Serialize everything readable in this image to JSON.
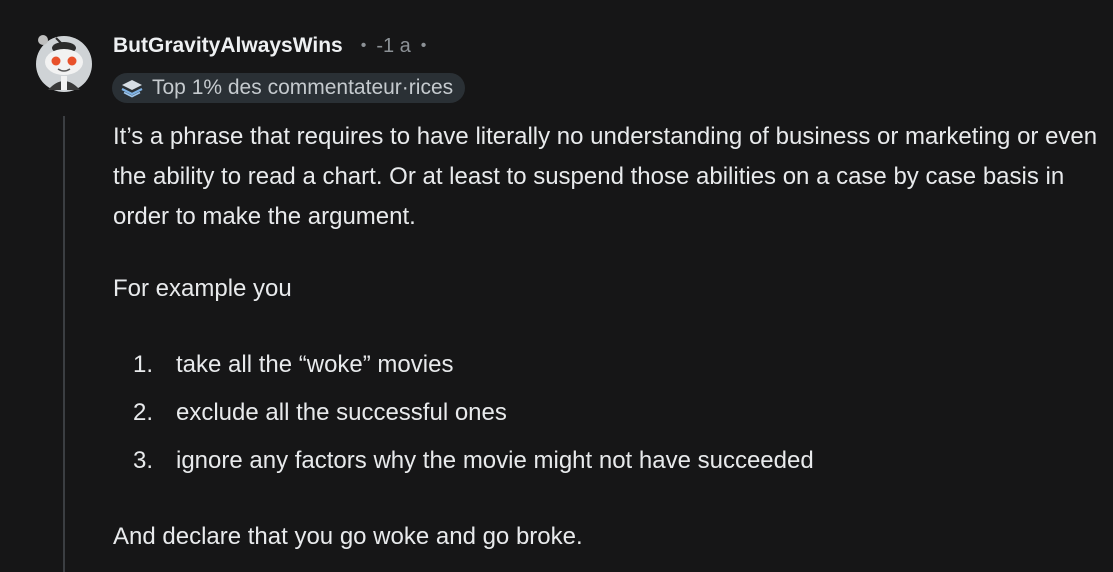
{
  "comment": {
    "author": "ButGravityAlwaysWins",
    "separator": "•",
    "time": "-1 a",
    "badge": {
      "label": "Top 1% des commentateur·rices",
      "icon": "top-commenter-badge-icon",
      "color": "#2a3035"
    },
    "avatar": {
      "icon": "snoo-avatar-icon",
      "accent": "#e8512b"
    },
    "body": {
      "paragraph1": "It’s a phrase that requires to have literally no understanding of business or marketing or even the ability to read a chart. Or at least to suspend those abilities on a case by case basis in order to make the argument.",
      "paragraph2": "For example you",
      "list": [
        {
          "number": "1.",
          "text": "take all the “woke” movies"
        },
        {
          "number": "2.",
          "text": "exclude all the successful ones"
        },
        {
          "number": "3.",
          "text": "ignore any factors why the movie might not have succeeded"
        }
      ],
      "paragraph3": "And declare that you go woke and go broke."
    }
  },
  "colors": {
    "background": "#161617",
    "text": "#e8eaec",
    "muted": "#8c9196",
    "thread_line": "#3b3e42"
  }
}
